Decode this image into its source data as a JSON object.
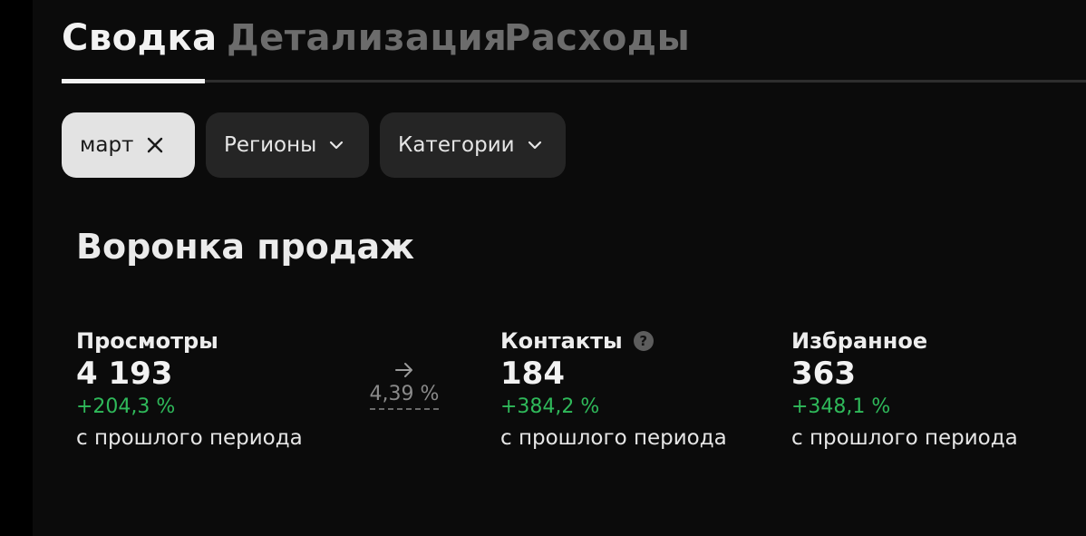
{
  "tabs": [
    {
      "label": "Сводка",
      "active": true
    },
    {
      "label": "Детализация",
      "active": false
    },
    {
      "label": "Расходы",
      "active": false
    }
  ],
  "filters": {
    "period": {
      "label": "март",
      "icon": "close-icon"
    },
    "regions": {
      "label": "Регионы",
      "icon": "chevron-down-icon"
    },
    "categories": {
      "label": "Категории",
      "icon": "chevron-down-icon"
    }
  },
  "funnel": {
    "title": "Воронка продаж",
    "views": {
      "label": "Просмотры",
      "value": "4 193",
      "change": "+204,3 %",
      "caption": "с прошлого периода"
    },
    "conversion": {
      "icon": "arrow-right-icon",
      "value": "4,39 %"
    },
    "contacts": {
      "label": "Контакты",
      "help": "?",
      "value": "184",
      "change": "+384,2 %",
      "caption": "с прошлого периода"
    },
    "favorites": {
      "label": "Избранное",
      "value": "363",
      "change": "+348,1 %",
      "caption": "с прошлого периода"
    }
  },
  "colors": {
    "background": "#0b0b0b",
    "positive": "#2fb95a",
    "chip": "#252525",
    "chip_selected": "#e3e3e3"
  }
}
